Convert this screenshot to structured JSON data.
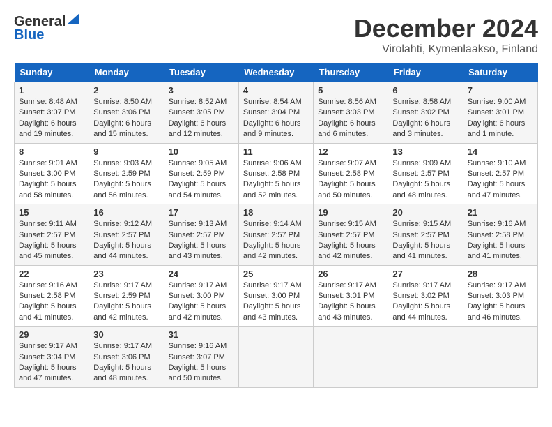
{
  "header": {
    "logo_general": "General",
    "logo_blue": "Blue",
    "month_title": "December 2024",
    "location": "Virolahti, Kymenlaakso, Finland"
  },
  "days_of_week": [
    "Sunday",
    "Monday",
    "Tuesday",
    "Wednesday",
    "Thursday",
    "Friday",
    "Saturday"
  ],
  "weeks": [
    [
      {
        "day": "1",
        "sunrise": "8:48 AM",
        "sunset": "3:07 PM",
        "daylight": "6 hours and 19 minutes."
      },
      {
        "day": "2",
        "sunrise": "8:50 AM",
        "sunset": "3:06 PM",
        "daylight": "6 hours and 15 minutes."
      },
      {
        "day": "3",
        "sunrise": "8:52 AM",
        "sunset": "3:05 PM",
        "daylight": "6 hours and 12 minutes."
      },
      {
        "day": "4",
        "sunrise": "8:54 AM",
        "sunset": "3:04 PM",
        "daylight": "6 hours and 9 minutes."
      },
      {
        "day": "5",
        "sunrise": "8:56 AM",
        "sunset": "3:03 PM",
        "daylight": "6 hours and 6 minutes."
      },
      {
        "day": "6",
        "sunrise": "8:58 AM",
        "sunset": "3:02 PM",
        "daylight": "6 hours and 3 minutes."
      },
      {
        "day": "7",
        "sunrise": "9:00 AM",
        "sunset": "3:01 PM",
        "daylight": "6 hours and 1 minute."
      }
    ],
    [
      {
        "day": "8",
        "sunrise": "9:01 AM",
        "sunset": "3:00 PM",
        "daylight": "5 hours and 58 minutes."
      },
      {
        "day": "9",
        "sunrise": "9:03 AM",
        "sunset": "2:59 PM",
        "daylight": "5 hours and 56 minutes."
      },
      {
        "day": "10",
        "sunrise": "9:05 AM",
        "sunset": "2:59 PM",
        "daylight": "5 hours and 54 minutes."
      },
      {
        "day": "11",
        "sunrise": "9:06 AM",
        "sunset": "2:58 PM",
        "daylight": "5 hours and 52 minutes."
      },
      {
        "day": "12",
        "sunrise": "9:07 AM",
        "sunset": "2:58 PM",
        "daylight": "5 hours and 50 minutes."
      },
      {
        "day": "13",
        "sunrise": "9:09 AM",
        "sunset": "2:57 PM",
        "daylight": "5 hours and 48 minutes."
      },
      {
        "day": "14",
        "sunrise": "9:10 AM",
        "sunset": "2:57 PM",
        "daylight": "5 hours and 47 minutes."
      }
    ],
    [
      {
        "day": "15",
        "sunrise": "9:11 AM",
        "sunset": "2:57 PM",
        "daylight": "5 hours and 45 minutes."
      },
      {
        "day": "16",
        "sunrise": "9:12 AM",
        "sunset": "2:57 PM",
        "daylight": "5 hours and 44 minutes."
      },
      {
        "day": "17",
        "sunrise": "9:13 AM",
        "sunset": "2:57 PM",
        "daylight": "5 hours and 43 minutes."
      },
      {
        "day": "18",
        "sunrise": "9:14 AM",
        "sunset": "2:57 PM",
        "daylight": "5 hours and 42 minutes."
      },
      {
        "day": "19",
        "sunrise": "9:15 AM",
        "sunset": "2:57 PM",
        "daylight": "5 hours and 42 minutes."
      },
      {
        "day": "20",
        "sunrise": "9:15 AM",
        "sunset": "2:57 PM",
        "daylight": "5 hours and 41 minutes."
      },
      {
        "day": "21",
        "sunrise": "9:16 AM",
        "sunset": "2:58 PM",
        "daylight": "5 hours and 41 minutes."
      }
    ],
    [
      {
        "day": "22",
        "sunrise": "9:16 AM",
        "sunset": "2:58 PM",
        "daylight": "5 hours and 41 minutes."
      },
      {
        "day": "23",
        "sunrise": "9:17 AM",
        "sunset": "2:59 PM",
        "daylight": "5 hours and 42 minutes."
      },
      {
        "day": "24",
        "sunrise": "9:17 AM",
        "sunset": "3:00 PM",
        "daylight": "5 hours and 42 minutes."
      },
      {
        "day": "25",
        "sunrise": "9:17 AM",
        "sunset": "3:00 PM",
        "daylight": "5 hours and 43 minutes."
      },
      {
        "day": "26",
        "sunrise": "9:17 AM",
        "sunset": "3:01 PM",
        "daylight": "5 hours and 43 minutes."
      },
      {
        "day": "27",
        "sunrise": "9:17 AM",
        "sunset": "3:02 PM",
        "daylight": "5 hours and 44 minutes."
      },
      {
        "day": "28",
        "sunrise": "9:17 AM",
        "sunset": "3:03 PM",
        "daylight": "5 hours and 46 minutes."
      }
    ],
    [
      {
        "day": "29",
        "sunrise": "9:17 AM",
        "sunset": "3:04 PM",
        "daylight": "5 hours and 47 minutes."
      },
      {
        "day": "30",
        "sunrise": "9:17 AM",
        "sunset": "3:06 PM",
        "daylight": "5 hours and 48 minutes."
      },
      {
        "day": "31",
        "sunrise": "9:16 AM",
        "sunset": "3:07 PM",
        "daylight": "5 hours and 50 minutes."
      },
      null,
      null,
      null,
      null
    ]
  ],
  "labels": {
    "sunrise": "Sunrise:",
    "sunset": "Sunset:",
    "daylight": "Daylight:"
  }
}
